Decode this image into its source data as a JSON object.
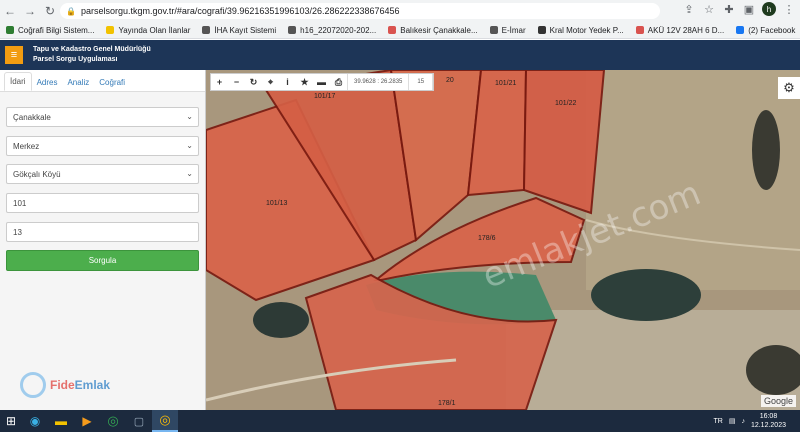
{
  "browser": {
    "url": "parselsorgu.tkgm.gov.tr/#ara/cografi/39.96216351996103/26.286222338676456",
    "profile_initial": "h"
  },
  "bookmarks": [
    {
      "label": "Coğrafi Bilgi Sistem...",
      "color": "#2e7d32"
    },
    {
      "label": "Yayında Olan İlanlar",
      "color": "#f2c200"
    },
    {
      "label": "İHA Kayıt Sistemi",
      "color": "#555555"
    },
    {
      "label": "h16_22072020-202...",
      "color": "#555555"
    },
    {
      "label": "Balıkesir Çanakkale...",
      "color": "#d9534f"
    },
    {
      "label": "E-İmar",
      "color": "#555555"
    },
    {
      "label": "Kral Motor Yedek P...",
      "color": "#333333"
    },
    {
      "label": "AKÜ 12V 28AH 6 D...",
      "color": "#d9534f"
    },
    {
      "label": "(2) Facebook",
      "color": "#1877f2"
    }
  ],
  "app": {
    "title_line1": "Tapu ve Kadastro Genel Müdürlüğü",
    "title_line2": "Parsel Sorgu Uygulaması"
  },
  "panel": {
    "tabs": [
      "İdari",
      "Adres",
      "Analiz",
      "Coğrafi"
    ],
    "province": "Çanakkale",
    "district": "Merkez",
    "village": "Gökçalı Köyü",
    "block": "101",
    "parcel": "13",
    "query_button": "Sorgula"
  },
  "logo": {
    "part1": "Fide",
    "part2": "Emlak"
  },
  "map": {
    "coordinates": "39.9628 : 26.2835",
    "zoom": "15",
    "watermark": "emlakjet.com",
    "attribution": "Google",
    "parcel_labels": [
      "101/17",
      "101/21",
      "101/22",
      "101/13",
      "178/6",
      "178/1",
      "20"
    ]
  },
  "taskbar": {
    "language": "TR",
    "time": "16:08",
    "date": "12.12.2023"
  }
}
